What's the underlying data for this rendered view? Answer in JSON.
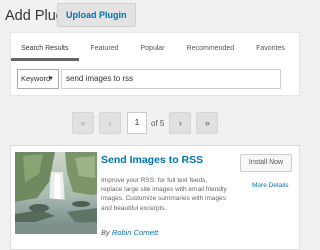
{
  "header": {
    "title": "Add Plugins",
    "upload_label": "Upload Plugin"
  },
  "tabs": [
    {
      "label": "Search Results",
      "active": true
    },
    {
      "label": "Featured"
    },
    {
      "label": "Popular"
    },
    {
      "label": "Recommended"
    },
    {
      "label": "Favorites"
    }
  ],
  "search": {
    "type_value": "Keyword",
    "query": "send images to rss"
  },
  "pagination": {
    "first": "«",
    "prev": "‹",
    "current_page": "1",
    "of_text": "of 5",
    "next": "›",
    "last": "»"
  },
  "plugin": {
    "title": "Send Images to RSS",
    "description": "Improve your RSS: for full text feeds, replace large site images with email friendly images. Customize summaries with images and beautiful excerpts.",
    "by_label": "By",
    "author": "Robin Cornett",
    "install_label": "Install Now",
    "more_details_label": "More Details",
    "thumbnail_icon": "waterfall-photo"
  },
  "colors": {
    "link": "#0073aa",
    "background": "#f1f1f1"
  }
}
